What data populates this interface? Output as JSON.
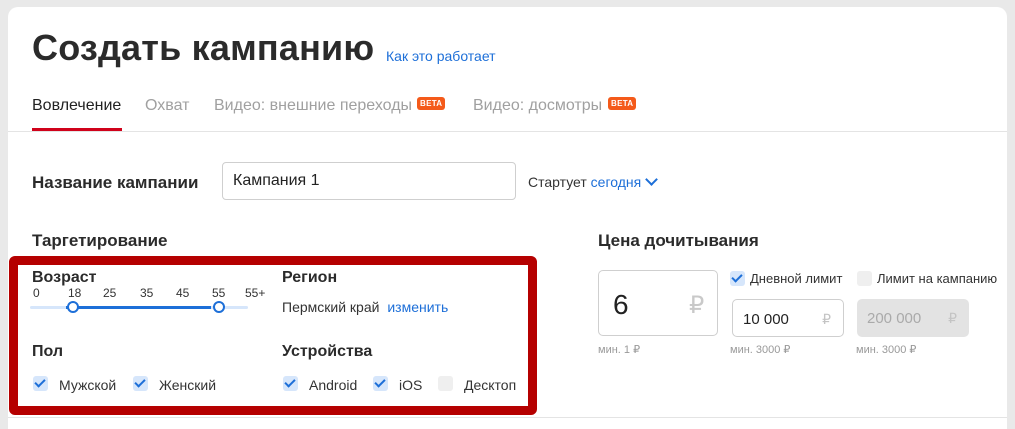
{
  "header": {
    "title": "Создать кампанию",
    "howto_link": "Как это работает"
  },
  "tabs": [
    {
      "label": "Вовлечение",
      "active": true,
      "badge": ""
    },
    {
      "label": "Охват",
      "active": false,
      "badge": ""
    },
    {
      "label": "Видео: внешние переходы",
      "active": false,
      "badge": "BETA"
    },
    {
      "label": "Видео: досмотры",
      "active": false,
      "badge": "BETA"
    }
  ],
  "campaign": {
    "name_label": "Название кампании",
    "name_value": "Кампания 1",
    "starts_label": "Стартует",
    "starts_value": "сегодня"
  },
  "targeting": {
    "title": "Таргетирование",
    "age": {
      "label": "Возраст",
      "ticks": [
        "0",
        "18",
        "25",
        "35",
        "45",
        "55",
        "55+"
      ],
      "selected_from": "18",
      "selected_to": "55"
    },
    "region": {
      "label": "Регион",
      "value": "Пермский край",
      "change_link": "изменить"
    },
    "gender": {
      "label": "Пол",
      "options": [
        {
          "label": "Мужской",
          "checked": true
        },
        {
          "label": "Женский",
          "checked": true
        }
      ]
    },
    "devices": {
      "label": "Устройства",
      "options": [
        {
          "label": "Android",
          "checked": true
        },
        {
          "label": "iOS",
          "checked": true
        },
        {
          "label": "Десктоп",
          "checked": false
        }
      ]
    }
  },
  "pricing": {
    "title": "Цена дочитывания",
    "price_value": "6",
    "currency": "₽",
    "price_hint": "мин. 1 ₽",
    "daily_limit": {
      "label": "Дневной лимит",
      "checked": true,
      "value": "10 000",
      "hint": "мин. 3000 ₽"
    },
    "campaign_limit": {
      "label": "Лимит на кампанию",
      "checked": false,
      "value": "200 000",
      "hint": "мин. 3000 ₽"
    }
  },
  "colors": {
    "accent": "#1d6fd8",
    "tab_underline": "#d0021b",
    "beta_badge": "#f45a1a",
    "highlight_frame": "#b50000"
  }
}
